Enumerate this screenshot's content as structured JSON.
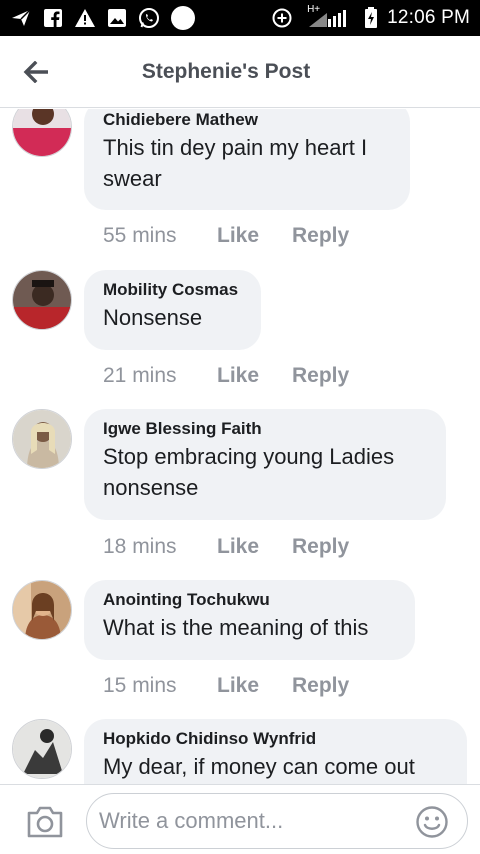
{
  "status_bar": {
    "time": "12:06 PM",
    "network_label": "H+",
    "icons_left": [
      "airplane-bird-icon",
      "facebook-icon",
      "warning-icon",
      "image-icon",
      "whatsapp-icon",
      "circle-icon"
    ],
    "icons_right": [
      "data-saver-icon",
      "signal-icon",
      "battery-charging-icon"
    ]
  },
  "header": {
    "title": "Stephenie's Post",
    "back_icon": "back-arrow-icon"
  },
  "comments": [
    {
      "author": "Chidiebere Mathew",
      "text": "This tin dey pain my heart I swear",
      "time": "55 mins",
      "like": "Like",
      "reply": "Reply"
    },
    {
      "author": "Mobility Cosmas",
      "text": "Nonsense",
      "time": "21 mins",
      "like": "Like",
      "reply": "Reply"
    },
    {
      "author": "Igwe Blessing Faith",
      "text": "Stop embracing young Ladies nonsense",
      "time": "18 mins",
      "like": "Like",
      "reply": "Reply"
    },
    {
      "author": "Anointing Tochukwu",
      "text": "What is the meaning of this",
      "time": "15 mins",
      "like": "Like",
      "reply": "Reply"
    },
    {
      "author": "Hopkido Chidinso Wynfrid",
      "text": "My dear, if money can come out",
      "time": "",
      "like": "",
      "reply": ""
    }
  ],
  "composer": {
    "placeholder": "Write a comment...",
    "camera_icon": "camera-icon",
    "emoji_icon": "emoji-smiley-icon"
  },
  "colors": {
    "bubble": "#f0f2f5",
    "meta_text": "#90949c",
    "title_text": "#4b4f56",
    "status_bar": "#000000"
  }
}
